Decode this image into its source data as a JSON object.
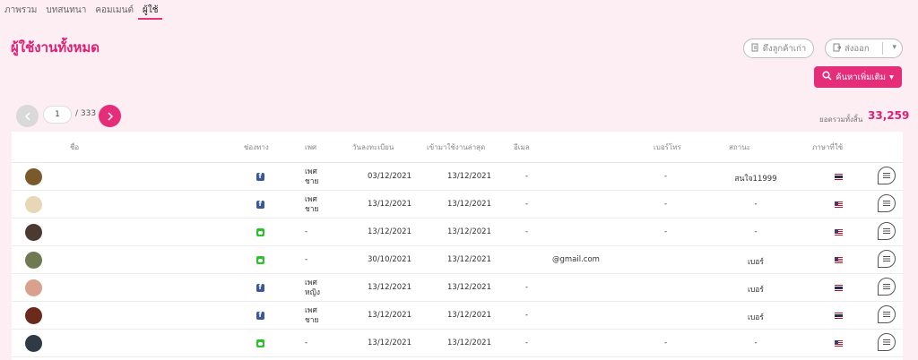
{
  "tabs": [
    {
      "label": "ภาพรวม"
    },
    {
      "label": "บทสนทนา"
    },
    {
      "label": "คอมเมนต์"
    },
    {
      "label": "ผู้ใช้"
    }
  ],
  "page_title": "ผู้ใช้งานทั้งหมด",
  "toolbar": {
    "import_label": "ดึงลูกค้าเก่า",
    "export_label": "ส่งออก",
    "search_label": "ค้นหาเพิ่มเติม"
  },
  "pager": {
    "current": "1",
    "total": "/ 333"
  },
  "total": {
    "label": "ยอดรวมทั้งสิ้น",
    "value": "33,259"
  },
  "table": {
    "columns": [
      "ชื่อ",
      "ช่องทาง",
      "เพศ",
      "วันลงทะเบียน",
      "เข้ามาใช้งานล่าสุด",
      "อีเมล",
      "เบอร์โทร",
      "สถานะ",
      "ภาษาที่ใช้"
    ],
    "rows": [
      {
        "channel": "facebook",
        "gender": "เพศ\nชาย",
        "registered": "03/12/2021",
        "last_active": "13/12/2021",
        "email": "-",
        "phone": "-",
        "status": "สนใจ11999",
        "language": "th",
        "avatar_color": "#7a5a2a"
      },
      {
        "channel": "facebook",
        "gender": "เพศ\nชาย",
        "registered": "13/12/2021",
        "last_active": "13/12/2021",
        "email": "-",
        "phone": "-",
        "status": "-",
        "language": "us",
        "avatar_color": "#e8d7b4"
      },
      {
        "channel": "line",
        "gender": "-",
        "registered": "13/12/2021",
        "last_active": "13/12/2021",
        "email": "-",
        "phone": "-",
        "status": "-",
        "language": "us",
        "avatar_color": "#4a3a30"
      },
      {
        "channel": "line",
        "gender": "-",
        "registered": "30/10/2021",
        "last_active": "13/12/2021",
        "email": "@gmail.com",
        "phone": "",
        "status": "เบอร์",
        "language": "us",
        "avatar_color": "#6f7a52"
      },
      {
        "channel": "facebook",
        "gender": "เพศ\nหญิง",
        "registered": "13/12/2021",
        "last_active": "13/12/2021",
        "email": "-",
        "phone": "",
        "status": "เบอร์",
        "language": "th",
        "avatar_color": "#d9a08e"
      },
      {
        "channel": "facebook",
        "gender": "เพศ\nชาย",
        "registered": "13/12/2021",
        "last_active": "13/12/2021",
        "email": "-",
        "phone": "",
        "status": "เบอร์",
        "language": "th",
        "avatar_color": "#6b2a1c"
      },
      {
        "channel": "line",
        "gender": "-",
        "registered": "13/12/2021",
        "last_active": "13/12/2021",
        "email": "-",
        "phone": "-",
        "status": "-",
        "language": "us",
        "avatar_color": "#2f3a45"
      }
    ]
  },
  "colors": {
    "accent": "#e62d7a",
    "background": "#fdeef4"
  }
}
